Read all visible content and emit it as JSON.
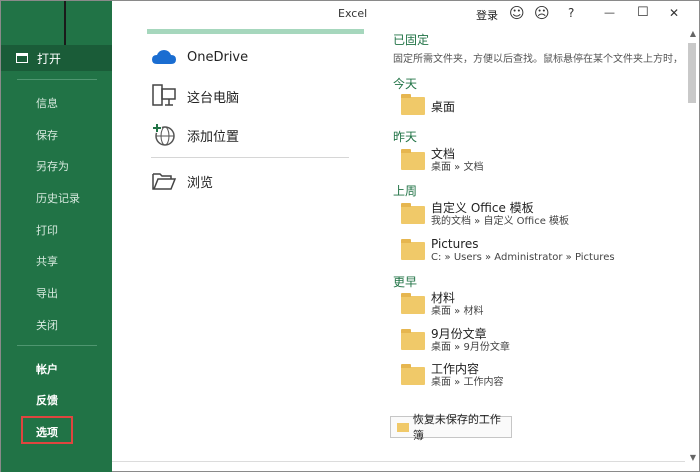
{
  "window": {
    "title": "Excel",
    "login": "登录"
  },
  "titlebar_icons": {
    "smile": "☺",
    "frown": "☹",
    "help": "?",
    "minimize": "—",
    "maximize": "☐",
    "close": "✕"
  },
  "sidebar": {
    "open_label": "打开",
    "items": [
      "信息",
      "保存",
      "另存为",
      "历史记录",
      "打印",
      "共享",
      "导出",
      "关闭"
    ],
    "bottom": [
      "帐户",
      "反馈",
      "选项"
    ]
  },
  "locations": [
    {
      "label": "OneDrive",
      "icon": "cloud-icon"
    },
    {
      "label": "这台电脑",
      "icon": "computer-icon"
    },
    {
      "label": "添加位置",
      "icon": "add-location-icon"
    },
    {
      "label": "浏览",
      "icon": "folder-open-icon"
    }
  ],
  "pinned": {
    "title": "已固定",
    "description": "固定所需文件夹，方便以后查找。鼠标悬停在某个文件夹上方时，单击"
  },
  "groups": {
    "today": "今天",
    "yesterday": "昨天",
    "last_week": "上周",
    "older": "更早"
  },
  "folders": {
    "desktop": {
      "name": "桌面"
    },
    "documents": {
      "name": "文档",
      "path": "桌面 » 文档"
    },
    "custom_office": {
      "name": "自定义 Office 模板",
      "path": "我的文档 » 自定义 Office 模板"
    },
    "pictures": {
      "name": "Pictures",
      "path": "C: » Users » Administrator » Pictures"
    },
    "materials": {
      "name": "材料",
      "path": "桌面 » 材料"
    },
    "sept_docs": {
      "name": "9月份文章",
      "path": "桌面 » 9月份文章"
    },
    "work": {
      "name": "工作内容",
      "path": "桌面 » 工作内容"
    }
  },
  "recover_label": "恢复未保存的工作簿",
  "colors": {
    "sidebar": "#217346",
    "accent": "#217346",
    "highlight_box": "#e0453f"
  }
}
